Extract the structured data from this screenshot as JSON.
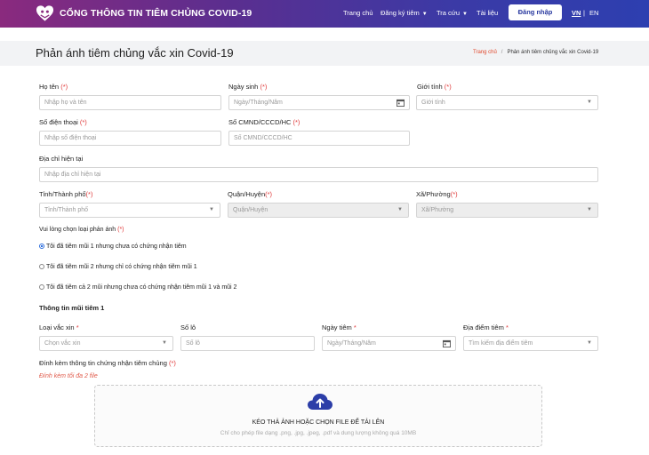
{
  "header": {
    "brand": "CỔNG THÔNG TIN TIÊM CHỦNG COVID-19",
    "nav": {
      "home": "Trang chủ",
      "register": "Đăng ký tiêm",
      "lookup": "Tra cứu",
      "docs": "Tài liệu"
    },
    "login_label": "Đăng nhập",
    "lang_vn": "VN",
    "lang_sep": "|",
    "lang_en": "EN"
  },
  "page": {
    "title": "Phản ánh tiêm chủng vắc xin Covid-19",
    "breadcrumb": {
      "home": "Trang chủ",
      "sep": "/",
      "current": "Phản ánh tiêm chủng vắc xin Covid-19"
    }
  },
  "form": {
    "full_name": {
      "label": "Họ tên",
      "req": "(*)",
      "placeholder": "Nhập họ và tên"
    },
    "dob": {
      "label": "Ngày sinh",
      "req": "(*)",
      "placeholder": "Ngày/Tháng/Năm"
    },
    "gender": {
      "label": "Giới tính",
      "req": "(*)",
      "placeholder": "Giới tính"
    },
    "phone": {
      "label": "Số điện thoại",
      "req": "(*)",
      "placeholder": "Nhập số điện thoại"
    },
    "id_number": {
      "label": "Số CMND/CCCD/HC",
      "req": "(*)",
      "placeholder": "Số CMND/CCCD/HC"
    },
    "address": {
      "label": "Địa chỉ hiện tại",
      "placeholder": "Nhập địa chỉ hiện tại"
    },
    "province": {
      "label": "Tỉnh/Thành phố",
      "req": "(*)",
      "placeholder": "Tỉnh/Thành phố"
    },
    "district": {
      "label": "Quận/Huyện",
      "req": "(*)",
      "placeholder": "Quận/Huyện"
    },
    "ward": {
      "label": "Xã/Phường",
      "req": "(*)",
      "placeholder": "Xã/Phường"
    },
    "report_type": {
      "label": "Vui lòng chọn loại phản ánh",
      "req": "(*)",
      "options": [
        "Tôi đã tiêm mũi 1 nhưng chưa có chứng nhận tiêm",
        "Tôi đã tiêm mũi 2 nhưng chỉ có chứng nhận tiêm mũi 1",
        "Tôi đã tiêm cả 2 mũi nhưng chưa có chứng nhận tiêm mũi 1 và mũi 2"
      ],
      "selected": "Tôi đã tiêm mũi 1 nhưng chưa có chứng nhận tiêm"
    },
    "dose1": {
      "section_title": "Thông tin mũi tiêm 1",
      "vaccine": {
        "label": "Loại vắc xin",
        "req": "*",
        "placeholder": "Chọn vắc xin"
      },
      "lot": {
        "label": "Số lô",
        "placeholder": "Số lô"
      },
      "date": {
        "label": "Ngày tiêm",
        "req": "*",
        "placeholder": "Ngày/Tháng/Năm"
      },
      "place": {
        "label": "Địa điểm tiêm",
        "req": "*",
        "placeholder": "Tìm kiếm địa điểm tiêm"
      }
    },
    "attachment": {
      "label": "Đính kèm thông tin chứng nhận tiêm chủng",
      "req": "(*)",
      "limit_note": "Đính kèm tối đa 2 file",
      "drop_title": "KÉO THẢ ẢNH HOẶC CHỌN FILE ĐỂ TẢI LÊN",
      "drop_hint": "Chỉ cho phép file dạng .png, .jpg, .jpeg, .pdf và dung lượng không quá 10MB"
    }
  },
  "colors": {
    "header_left": "#8a2a7e",
    "header_right": "#2d3fb0",
    "required": "#e03a3a",
    "radio_on": "#2f6fdd"
  }
}
